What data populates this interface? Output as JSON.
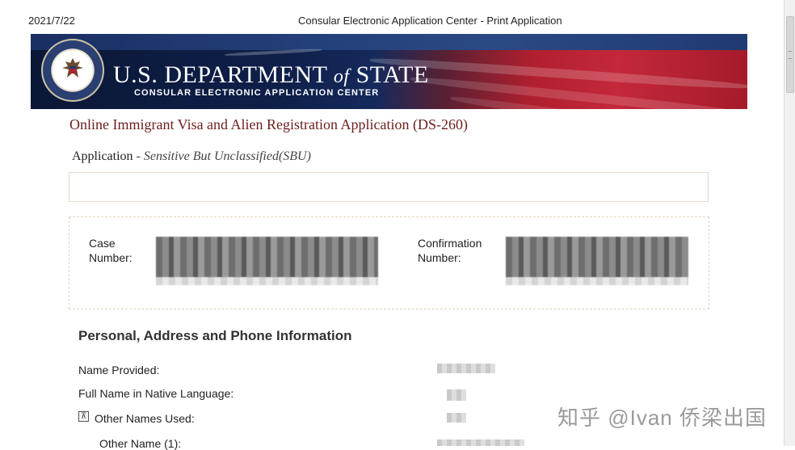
{
  "print_header": {
    "date": "2021/7/22",
    "title": "Consular Electronic Application Center - Print Application"
  },
  "banner": {
    "department": "U.S. DEPARTMENT of STATE",
    "department_main_1": "U.S. DEPARTMENT ",
    "department_of": "of",
    "department_main_2": " STATE",
    "subtitle": "CONSULAR ELECTRONIC APPLICATION CENTER"
  },
  "application": {
    "title": "Online Immigrant Visa and Alien Registration Application (DS-260)",
    "label": "Application",
    "separator": " - ",
    "classification": "Sensitive But Unclassified(SBU)"
  },
  "case_info": {
    "case_label_1": "Case",
    "case_label_2": "Number:",
    "confirmation_label_1": "Confirmation",
    "confirmation_label_2": "Number:"
  },
  "section": {
    "title": "Personal, Address and Phone Information",
    "fields": [
      {
        "label": "Name Provided:"
      },
      {
        "label": "Full Name in Native Language:"
      },
      {
        "label": "Other Names Used:"
      },
      {
        "label": "Other Name (1):"
      }
    ],
    "collapse_glyph": "⊼"
  },
  "watermark": "知乎 @Ivan 侨梁出国",
  "colors": {
    "title_red": "#6b1e1e",
    "banner_blue": "#0e1b3d",
    "banner_red": "#c4283a"
  }
}
